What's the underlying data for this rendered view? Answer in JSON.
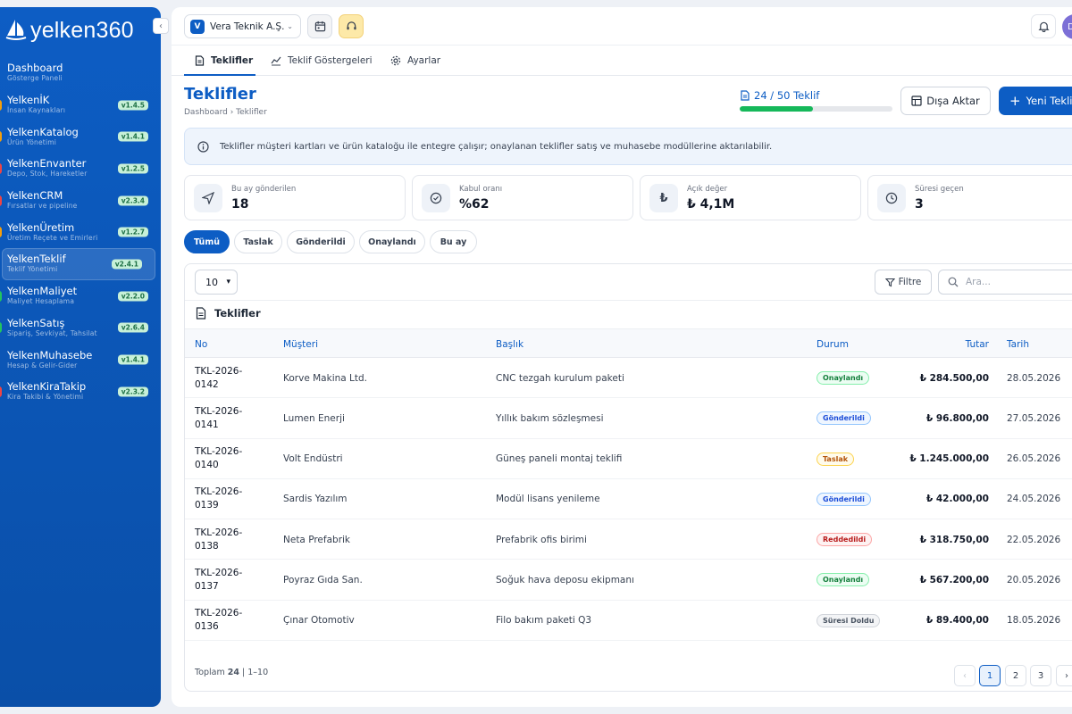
{
  "app": {
    "logo_text": "yelken360"
  },
  "sidebar": {
    "items": [
      {
        "title": "Dashboard",
        "sub": "Gösterge Paneli",
        "version": "",
        "dot": ""
      },
      {
        "title": "YelkenİK",
        "sub": "İnsan Kaynakları",
        "version": "v1.4.5",
        "dot": "#f59e0b"
      },
      {
        "title": "YelkenKatalog",
        "sub": "Ürün Yönetimi",
        "version": "v1.4.1",
        "dot": "#f59e0b"
      },
      {
        "title": "YelkenEnvanter",
        "sub": "Depo, Stok, Hareketler",
        "version": "v1.2.5",
        "dot": "#ef4444"
      },
      {
        "title": "YelkenCRM",
        "sub": "Fırsatlar ve pipeline",
        "version": "v2.3.4",
        "dot": "#ef4444"
      },
      {
        "title": "YelkenÜretim",
        "sub": "Üretim Reçete ve Emirleri",
        "version": "v1.2.7",
        "dot": "#f59e0b"
      },
      {
        "title": "YelkenTeklif",
        "sub": "Teklif Yönetimi",
        "version": "v2.4.1",
        "dot": ""
      },
      {
        "title": "YelkenMaliyet",
        "sub": "Maliyet Hesaplama",
        "version": "v2.2.0",
        "dot": "#22c55e"
      },
      {
        "title": "YelkenSatış",
        "sub": "Sipariş, Sevkiyat, Tahsilat",
        "version": "v2.6.4",
        "dot": "#22c55e"
      },
      {
        "title": "YelkenMuhasebe",
        "sub": "Hesap & Gelir-Gider",
        "version": "v1.4.1",
        "dot": ""
      },
      {
        "title": "YelkenKiraTakip",
        "sub": "Kira Takibi & Yönetimi",
        "version": "v2.3.2",
        "dot": "#ef4444"
      }
    ]
  },
  "topbar": {
    "company_initial": "V",
    "company_name": "Vera Teknik A.Ş.",
    "avatar_initial": "D"
  },
  "tabs": [
    {
      "label": "Teklifler"
    },
    {
      "label": "Teklif Göstergeleri"
    },
    {
      "label": "Ayarlar"
    }
  ],
  "page": {
    "title": "Teklifler",
    "breadcrumb": "Dashboard › Teklifler",
    "quota_text": "24 / 50 Teklif",
    "quota_used": 24,
    "quota_total": 50,
    "export_label": "Dışa Aktar",
    "new_label": "Yeni Teklif"
  },
  "info_text": "Teklifler müşteri kartları ve ürün kataloğu ile entegre çalışır; onaylanan teklifler satış ve muhasebe modüllerine aktarılabilir.",
  "stats": [
    {
      "label": "Bu ay gönderilen",
      "value": "18",
      "icon": "send-icon"
    },
    {
      "label": "Kabul oranı",
      "value": "%62",
      "icon": "check-circle-icon"
    },
    {
      "label": "Açık değer",
      "value": "₺ 4,1M",
      "icon": "lira-icon"
    },
    {
      "label": "Süresi geçen",
      "value": "3",
      "icon": "clock-icon"
    }
  ],
  "filters": [
    {
      "label": "Tümü"
    },
    {
      "label": "Taslak"
    },
    {
      "label": "Gönderildi"
    },
    {
      "label": "Onaylandı"
    },
    {
      "label": "Bu ay"
    }
  ],
  "table": {
    "page_size": "10",
    "filter_label": "Filtre",
    "search_placeholder": "Ara...",
    "title": "Teklifler",
    "columns": [
      "No",
      "Müşteri",
      "Başlık",
      "Durum",
      "Tutar",
      "Tarih"
    ],
    "rows": [
      {
        "no1": "TKL-2026-",
        "no2": "0142",
        "customer": "Korve Makina Ltd.",
        "title": "CNC tezgah kurulum paketi",
        "status": "Onaylandı",
        "amount": "₺ 284.500,00",
        "date": "28.05.2026"
      },
      {
        "no1": "TKL-2026-",
        "no2": "0141",
        "customer": "Lumen Enerji",
        "title": "Yıllık bakım sözleşmesi",
        "status": "Gönderildi",
        "amount": "₺ 96.800,00",
        "date": "27.05.2026"
      },
      {
        "no1": "TKL-2026-",
        "no2": "0140",
        "customer": "Volt Endüstri",
        "title": "Güneş paneli montaj teklifi",
        "status": "Taslak",
        "amount": "₺ 1.245.000,00",
        "date": "26.05.2026"
      },
      {
        "no1": "TKL-2026-",
        "no2": "0139",
        "customer": "Sardis Yazılım",
        "title": "Modül lisans yenileme",
        "status": "Gönderildi",
        "amount": "₺ 42.000,00",
        "date": "24.05.2026"
      },
      {
        "no1": "TKL-2026-",
        "no2": "0138",
        "customer": "Neta Prefabrik",
        "title": "Prefabrik ofis birimi",
        "status": "Reddedildi",
        "amount": "₺ 318.750,00",
        "date": "22.05.2026"
      },
      {
        "no1": "TKL-2026-",
        "no2": "0137",
        "customer": "Poyraz Gıda San.",
        "title": "Soğuk hava deposu ekipmanı",
        "status": "Onaylandı",
        "amount": "₺ 567.200,00",
        "date": "20.05.2026"
      },
      {
        "no1": "TKL-2026-",
        "no2": "0136",
        "customer": "Çınar Otomotiv",
        "title": "Filo bakım paketi Q3",
        "status": "Süresi Doldu",
        "amount": "₺ 89.400,00",
        "date": "18.05.2026"
      }
    ],
    "footer_prefix": "Toplam ",
    "footer_total": "24",
    "footer_suffix": " | 1–10",
    "pages": [
      "‹",
      "1",
      "2",
      "3",
      "›"
    ]
  },
  "status_colors": {
    "Onaylandı": {
      "fg": "#15803d",
      "bg": "#ecfdf3",
      "bd": "#86efac"
    },
    "Gönderildi": {
      "fg": "#1d4ed8",
      "bg": "#eff6ff",
      "bd": "#93c5fd"
    },
    "Taslak": {
      "fg": "#b45309",
      "bg": "#fffbeb",
      "bd": "#fcd34d"
    },
    "Reddedildi": {
      "fg": "#b91c1c",
      "bg": "#fef2f2",
      "bd": "#fca5a5"
    },
    "Süresi Doldu": {
      "fg": "#4b5563",
      "bg": "#f3f4f6",
      "bd": "#d1d5db"
    }
  }
}
